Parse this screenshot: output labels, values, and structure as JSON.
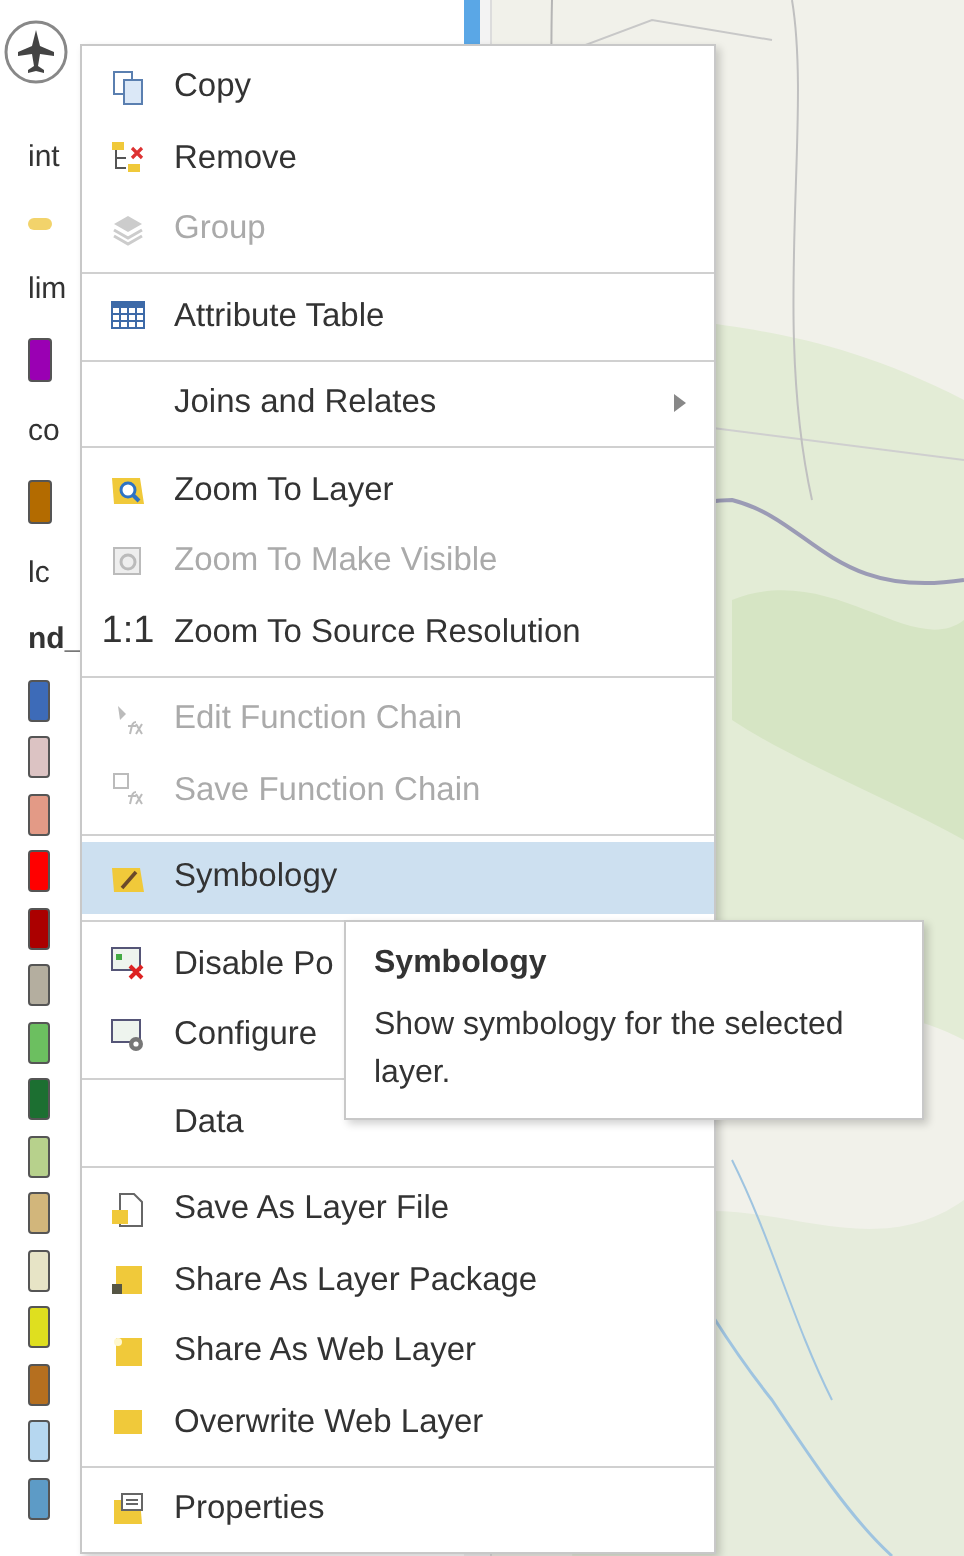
{
  "contents_pane": {
    "entries": [
      {
        "kind": "label",
        "text": "int"
      },
      {
        "kind": "line",
        "color": "#f2d36b"
      },
      {
        "kind": "label",
        "text": "lim"
      },
      {
        "kind": "swatch",
        "color": "#9a00b3"
      },
      {
        "kind": "label",
        "text": "co"
      },
      {
        "kind": "swatch",
        "color": "#b36b00"
      },
      {
        "kind": "label",
        "text": "lc"
      },
      {
        "kind": "heading",
        "text": "nd_"
      },
      {
        "kind": "class",
        "color": "#3d6bb8"
      },
      {
        "kind": "class",
        "color": "#dcc3c3"
      },
      {
        "kind": "class",
        "color": "#e39a86"
      },
      {
        "kind": "class",
        "color": "#ff0000"
      },
      {
        "kind": "class",
        "color": "#ab0000"
      },
      {
        "kind": "class",
        "color": "#b4ae9f"
      },
      {
        "kind": "class",
        "color": "#6cbf60"
      },
      {
        "kind": "class",
        "color": "#1c6f31"
      },
      {
        "kind": "class",
        "color": "#b7d18c"
      },
      {
        "kind": "class",
        "color": "#d2b67b"
      },
      {
        "kind": "class",
        "color": "#e7e4c6"
      },
      {
        "kind": "class",
        "color": "#dfdf1f"
      },
      {
        "kind": "class",
        "color": "#b56f1f"
      },
      {
        "kind": "class",
        "color": "#b6d7f0"
      },
      {
        "kind": "class",
        "color": "#5d9bc6"
      }
    ]
  },
  "context_menu": {
    "groups": [
      [
        {
          "label": "Copy",
          "disabled": false,
          "selected": false,
          "submenu": false
        },
        {
          "label": "Remove",
          "disabled": false,
          "selected": false,
          "submenu": false
        },
        {
          "label": "Group",
          "disabled": true,
          "selected": false,
          "submenu": false
        }
      ],
      [
        {
          "label": "Attribute Table",
          "disabled": false,
          "selected": false,
          "submenu": false
        }
      ],
      [
        {
          "label": "Joins and Relates",
          "disabled": false,
          "selected": false,
          "submenu": true
        }
      ],
      [
        {
          "label": "Zoom To Layer",
          "disabled": false,
          "selected": false,
          "submenu": false
        },
        {
          "label": "Zoom To Make Visible",
          "disabled": true,
          "selected": false,
          "submenu": false
        },
        {
          "label": "Zoom To Source Resolution",
          "glyph": "1:1",
          "disabled": false,
          "selected": false,
          "submenu": false
        }
      ],
      [
        {
          "label": "Edit Function Chain",
          "disabled": true,
          "selected": false,
          "submenu": false
        },
        {
          "label": "Save Function Chain",
          "disabled": true,
          "selected": false,
          "submenu": false
        }
      ],
      [
        {
          "label": "Symbology",
          "disabled": false,
          "selected": true,
          "submenu": false
        }
      ],
      [
        {
          "label": "Disable Po",
          "disabled": false,
          "selected": false
        },
        {
          "label": "Configure",
          "disabled": false,
          "selected": false
        }
      ],
      [
        {
          "label": "Data",
          "disabled": false,
          "selected": false
        }
      ],
      [
        {
          "label": "Save As Layer File",
          "disabled": false,
          "selected": false,
          "submenu": false
        },
        {
          "label": "Share As Layer Package",
          "disabled": false,
          "selected": false,
          "submenu": false
        },
        {
          "label": "Share As Web Layer",
          "disabled": false,
          "selected": false,
          "submenu": false
        },
        {
          "label": "Overwrite Web Layer",
          "disabled": false,
          "selected": false,
          "submenu": false
        }
      ],
      [
        {
          "label": "Properties",
          "disabled": false,
          "selected": false,
          "submenu": false
        }
      ]
    ]
  },
  "tooltip": {
    "title": "Symbology",
    "text": "Show symbology for the selected layer."
  }
}
